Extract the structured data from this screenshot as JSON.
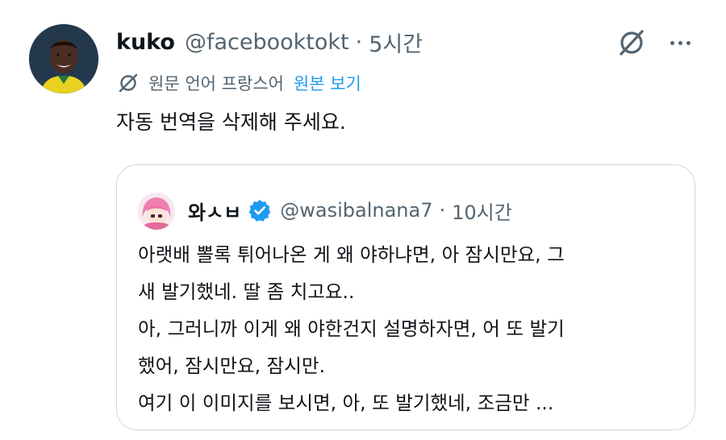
{
  "tweet": {
    "display_name": "kuko",
    "handle": "@facebooktokt",
    "separator": "·",
    "time": "5시간",
    "grok_icon": "grok-icon",
    "more_icon": "more-horizontal-icon",
    "translation_note": "원문 언어 프랑스어",
    "show_original": "원본 보기",
    "text": "자동 번역을 삭제해 주세요."
  },
  "quoted_tweet": {
    "display_name": "와ㅅㅂ",
    "verified_icon": "verified-badge-icon",
    "handle": "@wasibalnana7",
    "separator": "·",
    "time": "10시간",
    "lines": [
      "아랫배 뽈록 튀어나온 게 왜 야하냐면, 아 잠시만요, 그",
      "새 발기했네. 딸 좀 치고요..",
      "아, 그러니까 이게 왜 야한건지 설명하자면, 어 또 발기",
      "했어, 잠시만요, 잠시만.",
      "여기 이 이미지를 보시면, 아, 또 발기했네, 조금만 ..."
    ]
  },
  "colors": {
    "text": "#0f1419",
    "secondary": "#536471",
    "link": "#1d9bf0",
    "border": "#cfd9de",
    "verified": "#1d9bf0"
  }
}
